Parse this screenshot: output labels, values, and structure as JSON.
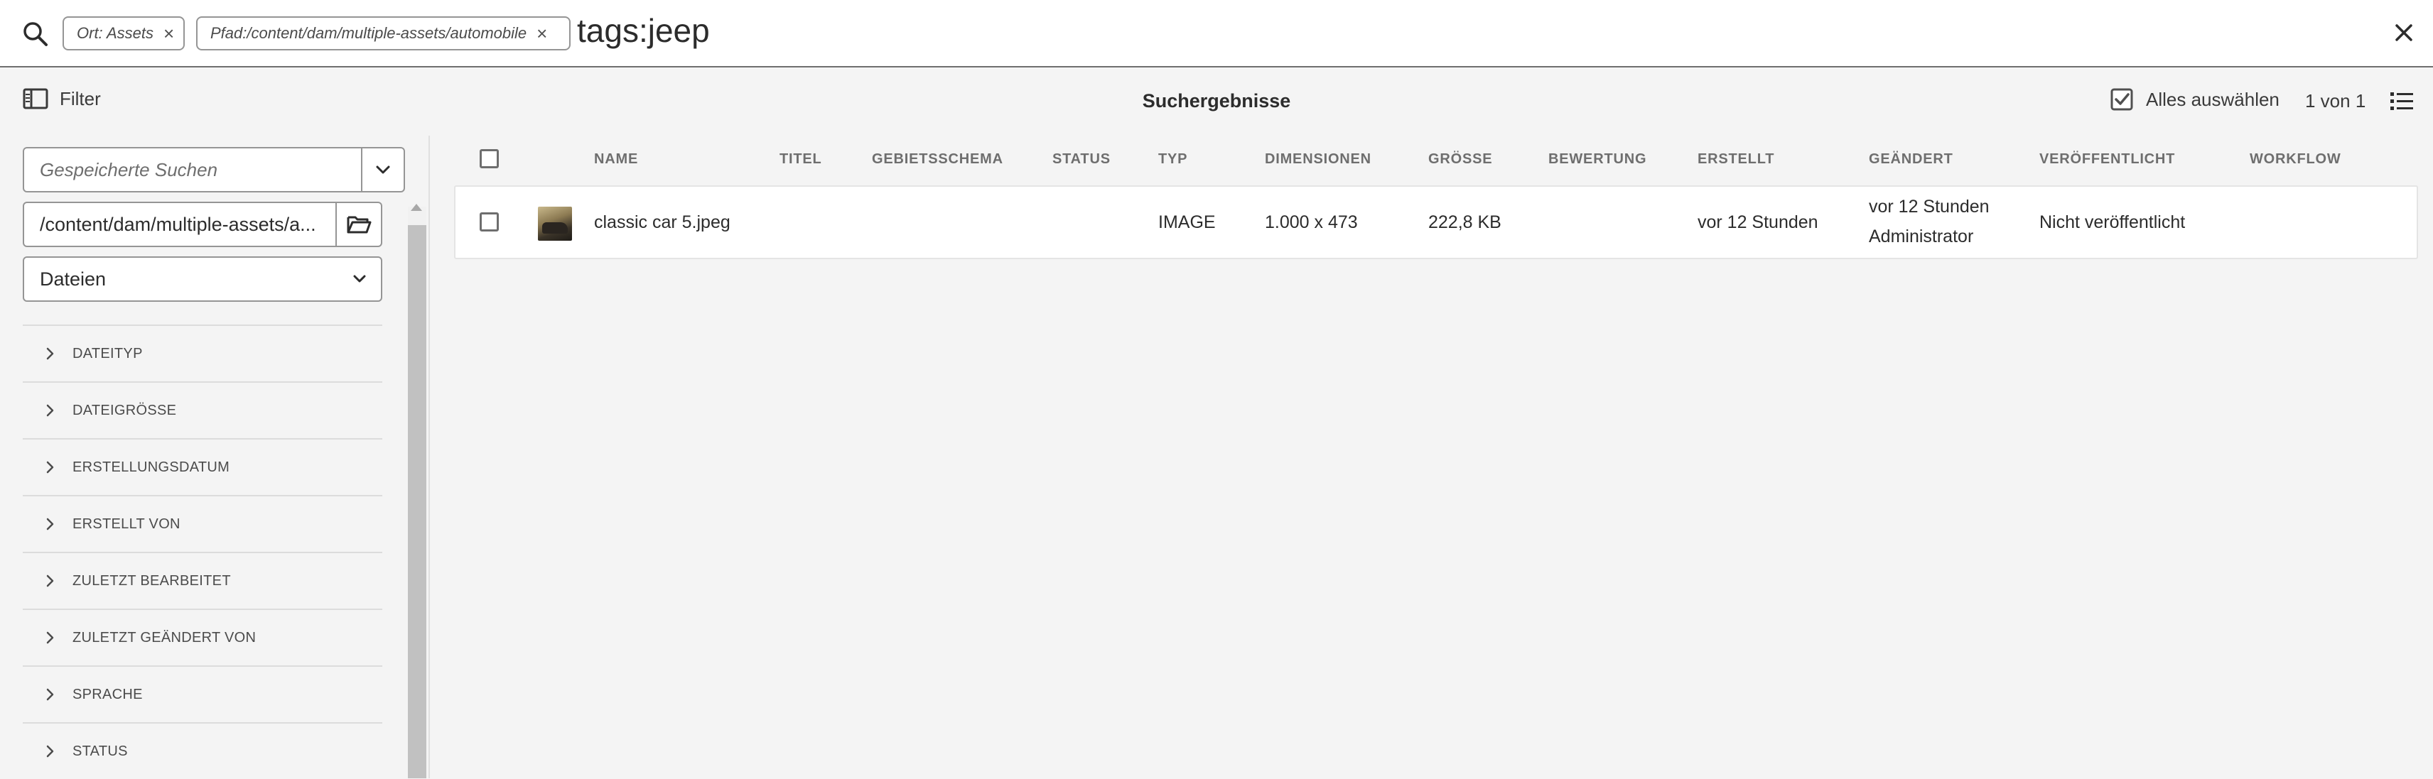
{
  "search": {
    "tags": [
      {
        "prefix": "Ort:",
        "value": " Assets"
      },
      {
        "prefix": "Pfad:",
        "value": "/content/dam/multiple-assets/automobile"
      }
    ],
    "query": "tags:jeep"
  },
  "actionbar": {
    "filter_label": "Filter",
    "title": "Suchergebnisse",
    "select_all_label": "Alles auswählen",
    "page_count": "1 von 1"
  },
  "rail": {
    "saved_search_placeholder": "Gespeicherte Suchen",
    "path_value": "/content/dam/multiple-assets/a...",
    "type_value": "Dateien",
    "facets": [
      "DATEITYP",
      "DATEIGRÖSSE",
      "ERSTELLUNGSDATUM",
      "ERSTELLT VON",
      "ZULETZT BEARBEITET",
      "ZULETZT GEÄNDERT VON",
      "SPRACHE",
      "STATUS"
    ]
  },
  "table": {
    "columns": {
      "name": "NAME",
      "titel": "TITEL",
      "gebietsschema": "GEBIETSSCHEMA",
      "status": "STATUS",
      "typ": "TYP",
      "dimensionen": "DIMENSIONEN",
      "groesse": "GRÖSSE",
      "bewertung": "BEWERTUNG",
      "erstellt": "ERSTELLT",
      "geaendert": "GEÄNDERT",
      "veroeffentlicht": "VERÖFFENTLICHT",
      "workflow": "WORKFLOW"
    },
    "rows": [
      {
        "name": "classic car 5.jpeg",
        "typ": "IMAGE",
        "dimensionen": "1.000 x 473",
        "groesse": "222,8 KB",
        "erstellt": "vor 12 Stunden",
        "geaendert_time": "vor 12 Stunden",
        "geaendert_by": "Administrator",
        "veroeffentlicht": "Nicht veröffentlicht"
      }
    ]
  },
  "colors": {
    "background": "#f4f4f4",
    "surface": "#ffffff",
    "border": "#959595",
    "text": "#2c2c2c",
    "muted": "#6e6e6e"
  }
}
